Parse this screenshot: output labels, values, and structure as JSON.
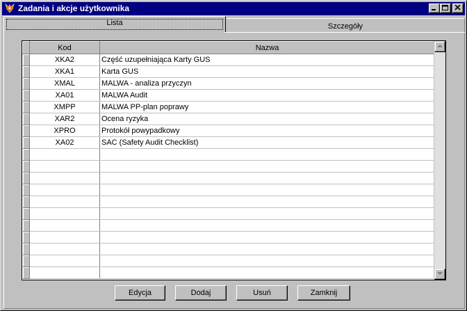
{
  "window": {
    "title": "Zadania i akcje użytkownika"
  },
  "tabs": [
    {
      "label": "Lista",
      "active": true
    },
    {
      "label": "Szczegóły",
      "active": false
    }
  ],
  "grid": {
    "columns": [
      "Kod",
      "Nazwa"
    ],
    "rows": [
      {
        "kod": "XKA2",
        "nazwa": "Część uzupełniająca Karty GUS"
      },
      {
        "kod": "XKA1",
        "nazwa": "Karta GUS"
      },
      {
        "kod": "XMAL",
        "nazwa": "MALWA - analiza przyczyn"
      },
      {
        "kod": "XA01",
        "nazwa": "MALWA Audit"
      },
      {
        "kod": "XMPP",
        "nazwa": "MALWA PP-plan poprawy"
      },
      {
        "kod": "XAR2",
        "nazwa": "Ocena ryzyka"
      },
      {
        "kod": "XPRO",
        "nazwa": "Protokół powypadkowy"
      },
      {
        "kod": "XA02",
        "nazwa": "SAC (Safety Audit Checklist)"
      }
    ],
    "empty_rows": 11
  },
  "buttons": {
    "edit": "Edycja",
    "add": "Dodaj",
    "delete": "Usuń",
    "close": "Zamknij"
  }
}
